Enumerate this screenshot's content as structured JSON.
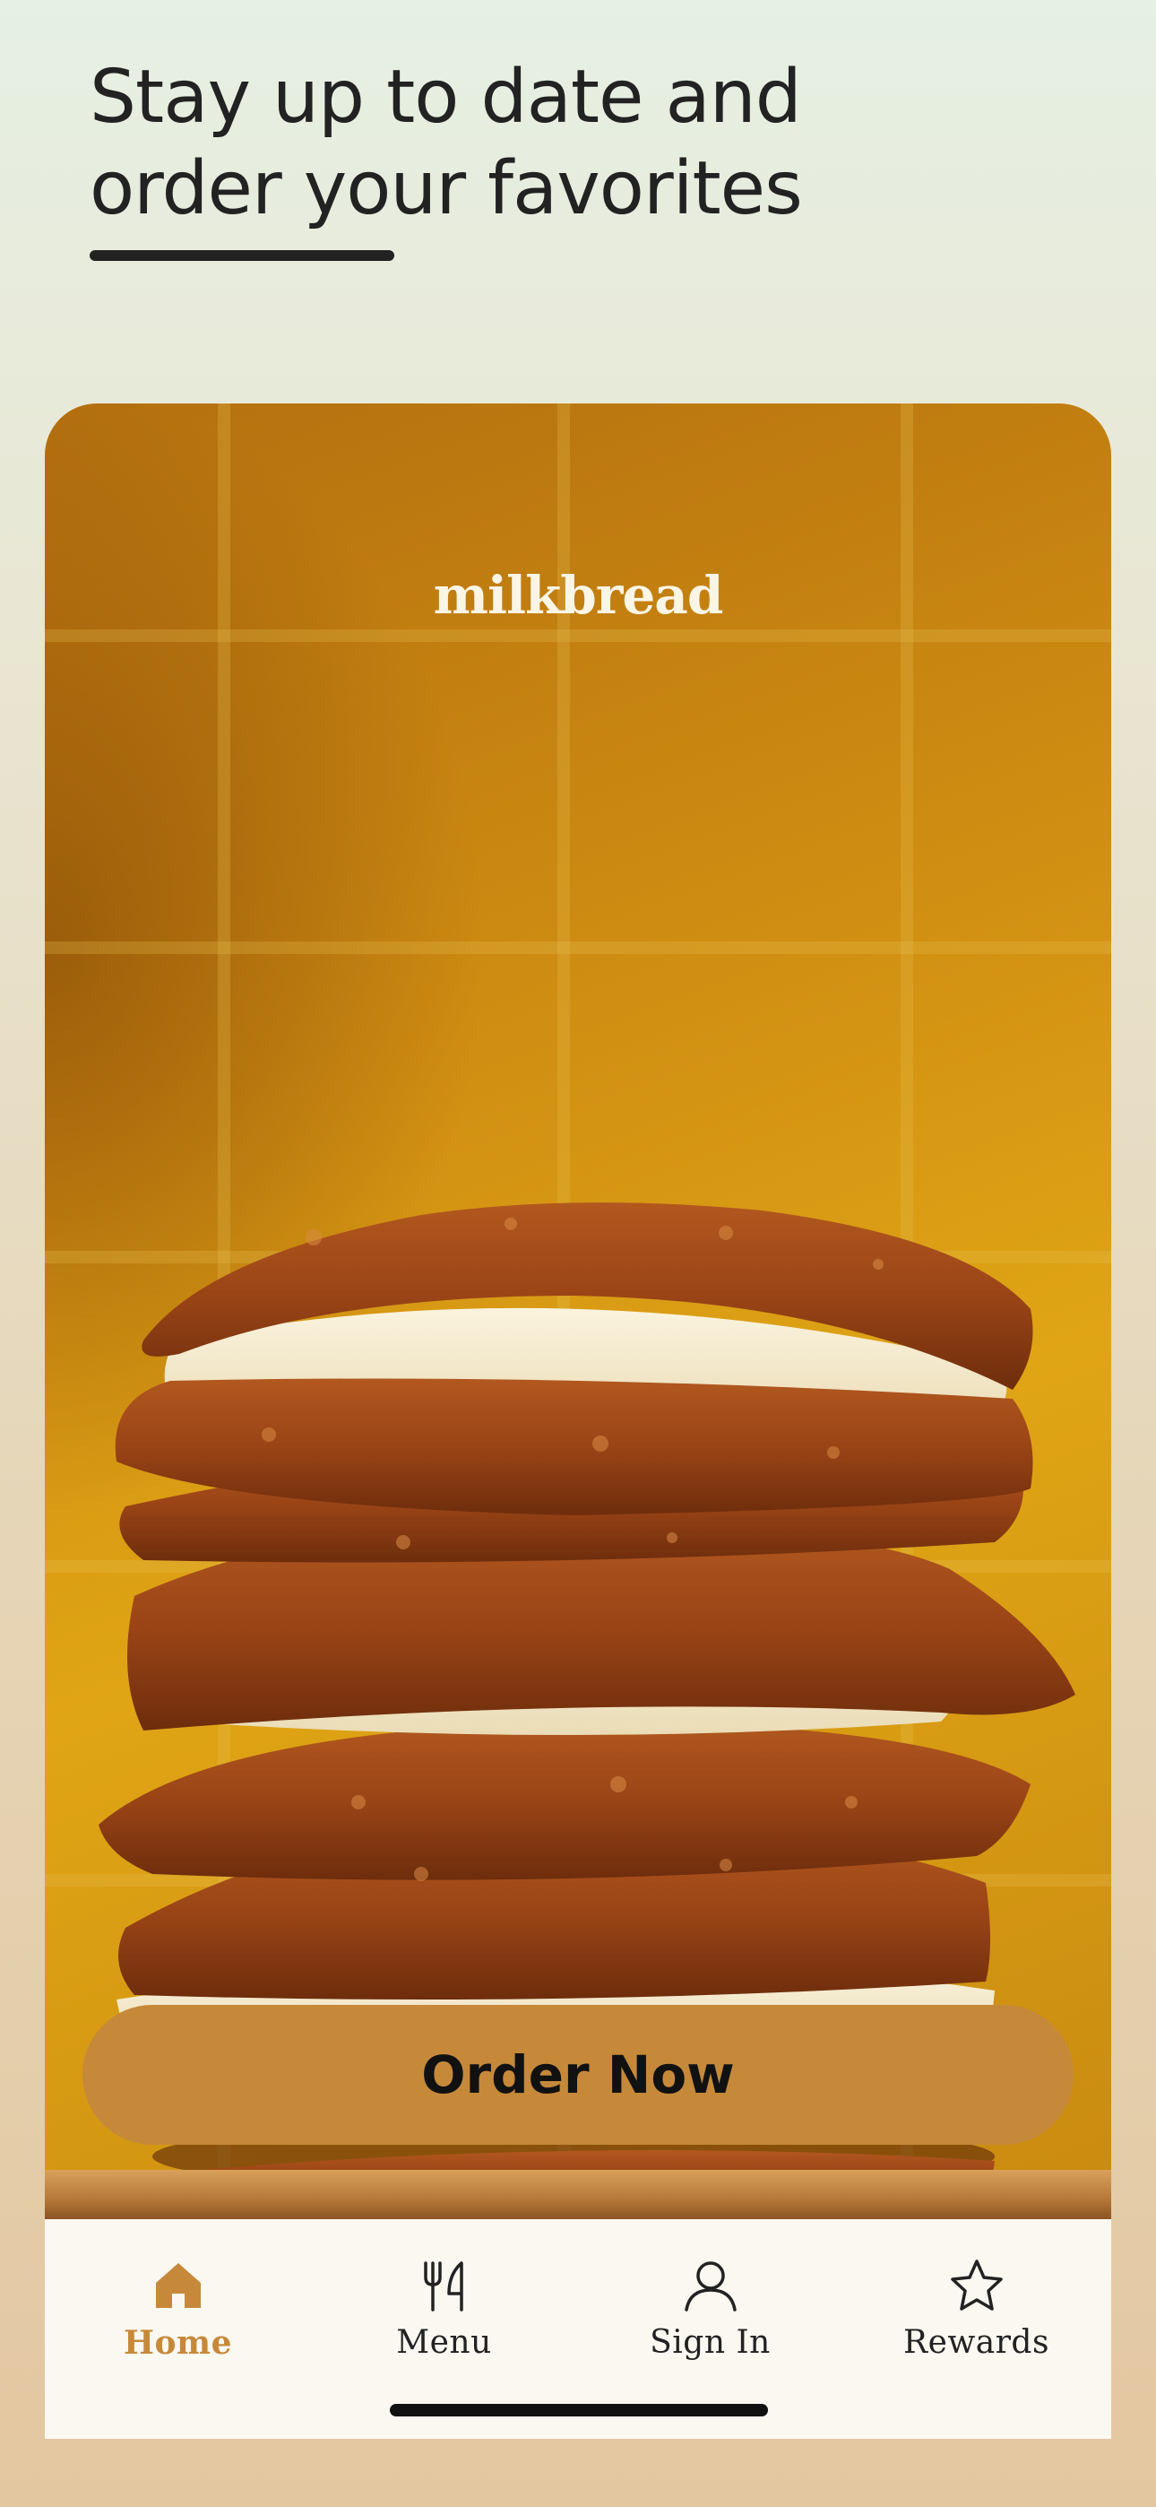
{
  "header": {
    "title_line1": "Stay up to date and",
    "title_line2": "order your favorites"
  },
  "hero": {
    "brand": "milkbread",
    "image_description_icon": "cookie-stack-image"
  },
  "cta": {
    "label": "Order Now"
  },
  "tabbar": {
    "items": [
      {
        "label": "Home",
        "icon": "home-icon",
        "active": true
      },
      {
        "label": "Menu",
        "icon": "fork-knife-icon",
        "active": false
      },
      {
        "label": "Sign In",
        "icon": "person-icon",
        "active": false
      },
      {
        "label": "Rewards",
        "icon": "star-icon",
        "active": false
      }
    ]
  },
  "colors": {
    "accent": "#c6893a",
    "text": "#222222",
    "tabbar_bg": "#fbf8f1"
  }
}
